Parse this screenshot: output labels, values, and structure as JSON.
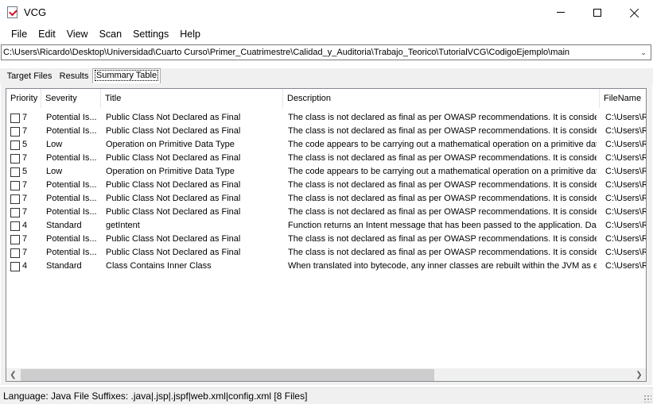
{
  "window": {
    "title": "VCG",
    "icon": "vcg-app-icon"
  },
  "menu": [
    "File",
    "Edit",
    "View",
    "Scan",
    "Settings",
    "Help"
  ],
  "path": {
    "value": "C:\\Users\\Ricardo\\Desktop\\Universidad\\Cuarto Curso\\Primer_Cuatrimestre\\Calidad_y_Auditoria\\Trabajo_Teorico\\TutorialVCG\\CodigoEjemplo\\main"
  },
  "tabs": [
    "Target Files",
    "Results",
    "Summary Table"
  ],
  "active_tab": "Summary Table",
  "table": {
    "columns": [
      "Priority",
      "Severity",
      "Title",
      "Description",
      "FileName"
    ],
    "rows": [
      {
        "checked": false,
        "priority": "7",
        "severity": "Potential Is...",
        "title": "Public Class Not Declared as Final",
        "description": "The class is not declared as final as per OWASP recommendations. It is conside...",
        "file": "C:\\Users\\R"
      },
      {
        "checked": false,
        "priority": "7",
        "severity": "Potential Is...",
        "title": "Public Class Not Declared as Final",
        "description": "The class is not declared as final as per OWASP recommendations. It is conside...",
        "file": "C:\\Users\\R"
      },
      {
        "checked": false,
        "priority": "5",
        "severity": "Low",
        "title": "Operation on Primitive Data Type",
        "description": "The code appears to be carrying out a mathematical operation on a primitive dat...",
        "file": "C:\\Users\\R"
      },
      {
        "checked": false,
        "priority": "7",
        "severity": "Potential Is...",
        "title": "Public Class Not Declared as Final",
        "description": "The class is not declared as final as per OWASP recommendations. It is conside...",
        "file": "C:\\Users\\R"
      },
      {
        "checked": false,
        "priority": "5",
        "severity": "Low",
        "title": "Operation on Primitive Data Type",
        "description": "The code appears to be carrying out a mathematical operation on a primitive dat...",
        "file": "C:\\Users\\R"
      },
      {
        "checked": false,
        "priority": "7",
        "severity": "Potential Is...",
        "title": "Public Class Not Declared as Final",
        "description": "The class is not declared as final as per OWASP recommendations. It is conside...",
        "file": "C:\\Users\\R"
      },
      {
        "checked": false,
        "priority": "7",
        "severity": "Potential Is...",
        "title": "Public Class Not Declared as Final",
        "description": "The class is not declared as final as per OWASP recommendations. It is conside...",
        "file": "C:\\Users\\R"
      },
      {
        "checked": false,
        "priority": "7",
        "severity": "Potential Is...",
        "title": "Public Class Not Declared as Final",
        "description": "The class is not declared as final as per OWASP recommendations. It is conside...",
        "file": "C:\\Users\\R"
      },
      {
        "checked": false,
        "priority": "4",
        "severity": "Standard",
        "title": "getIntent",
        "description": "Function returns an Intent message that has been passed to the application.  Da...",
        "file": "C:\\Users\\R"
      },
      {
        "checked": false,
        "priority": "7",
        "severity": "Potential Is...",
        "title": "Public Class Not Declared as Final",
        "description": "The class is not declared as final as per OWASP recommendations. It is conside...",
        "file": "C:\\Users\\R"
      },
      {
        "checked": false,
        "priority": "7",
        "severity": "Potential Is...",
        "title": "Public Class Not Declared as Final",
        "description": "The class is not declared as final as per OWASP recommendations. It is conside...",
        "file": "C:\\Users\\R"
      },
      {
        "checked": false,
        "priority": "4",
        "severity": "Standard",
        "title": "Class Contains Inner Class",
        "description": "When translated into bytecode, any inner classes are rebuilt within the JVM as e...",
        "file": "C:\\Users\\R"
      }
    ]
  },
  "status": {
    "text": "Language: Java   File Suffixes: .java|.jsp|.jspf|web.xml|config.xml   [8 Files]"
  }
}
